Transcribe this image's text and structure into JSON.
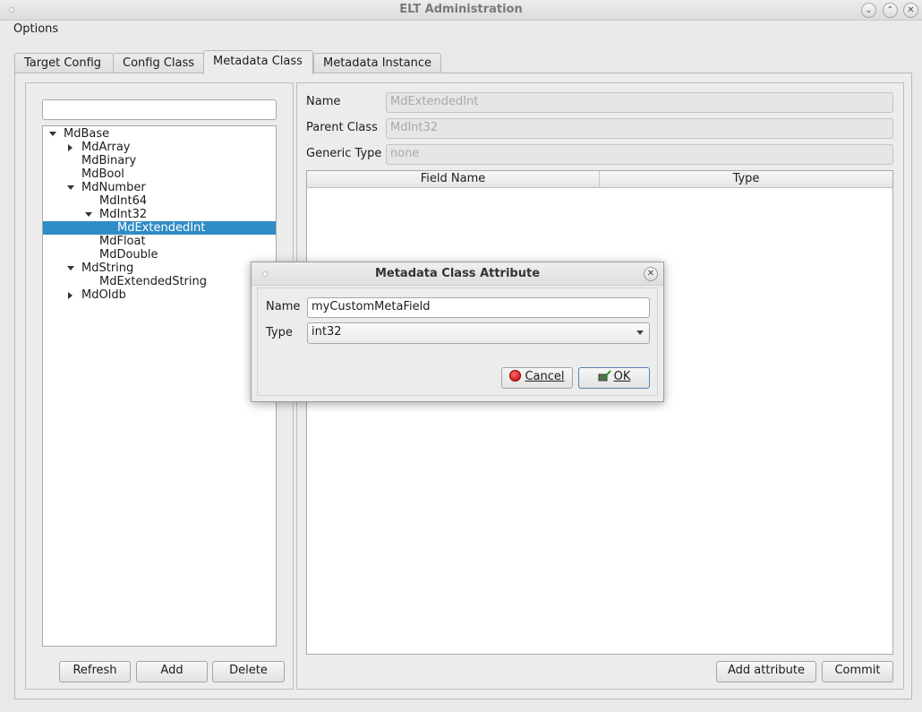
{
  "window": {
    "title": "ELT Administration"
  },
  "menu": {
    "options": "Options"
  },
  "tabs": [
    {
      "label": "Target Config"
    },
    {
      "label": "Config Class"
    },
    {
      "label": "Metadata Class"
    },
    {
      "label": "Metadata Instance"
    }
  ],
  "left": {
    "search_value": "",
    "tree": [
      {
        "label": "MdBase",
        "level": 0,
        "expander": "down"
      },
      {
        "label": "MdArray",
        "level": 1,
        "expander": "right"
      },
      {
        "label": "MdBinary",
        "level": 1,
        "expander": "none"
      },
      {
        "label": "MdBool",
        "level": 1,
        "expander": "none"
      },
      {
        "label": "MdNumber",
        "level": 1,
        "expander": "down"
      },
      {
        "label": "MdInt64",
        "level": 2,
        "expander": "none"
      },
      {
        "label": "MdInt32",
        "level": 2,
        "expander": "down"
      },
      {
        "label": "MdExtendedInt",
        "level": 3,
        "expander": "none",
        "selected": true
      },
      {
        "label": "MdFloat",
        "level": 2,
        "expander": "none"
      },
      {
        "label": "MdDouble",
        "level": 2,
        "expander": "none"
      },
      {
        "label": "MdString",
        "level": 1,
        "expander": "down"
      },
      {
        "label": "MdExtendedString",
        "level": 2,
        "expander": "none"
      },
      {
        "label": "MdOldb",
        "level": 1,
        "expander": "right"
      }
    ],
    "buttons": {
      "refresh": "Refresh",
      "add": "Add",
      "delete": "Delete"
    }
  },
  "right": {
    "name_label": "Name",
    "name_value": "MdExtendedInt",
    "parent_label": "Parent Class",
    "parent_value": "MdInt32",
    "generic_label": "Generic Type",
    "generic_value": "none",
    "table_headers": {
      "field_name": "Field Name",
      "type": "Type"
    },
    "buttons": {
      "add_attribute": "Add attribute",
      "commit": "Commit"
    }
  },
  "dialog": {
    "title": "Metadata Class Attribute",
    "name_label": "Name",
    "name_value": "myCustomMetaField",
    "type_label": "Type",
    "type_value": "int32",
    "cancel_label": "Cancel",
    "ok_label": "OK"
  }
}
